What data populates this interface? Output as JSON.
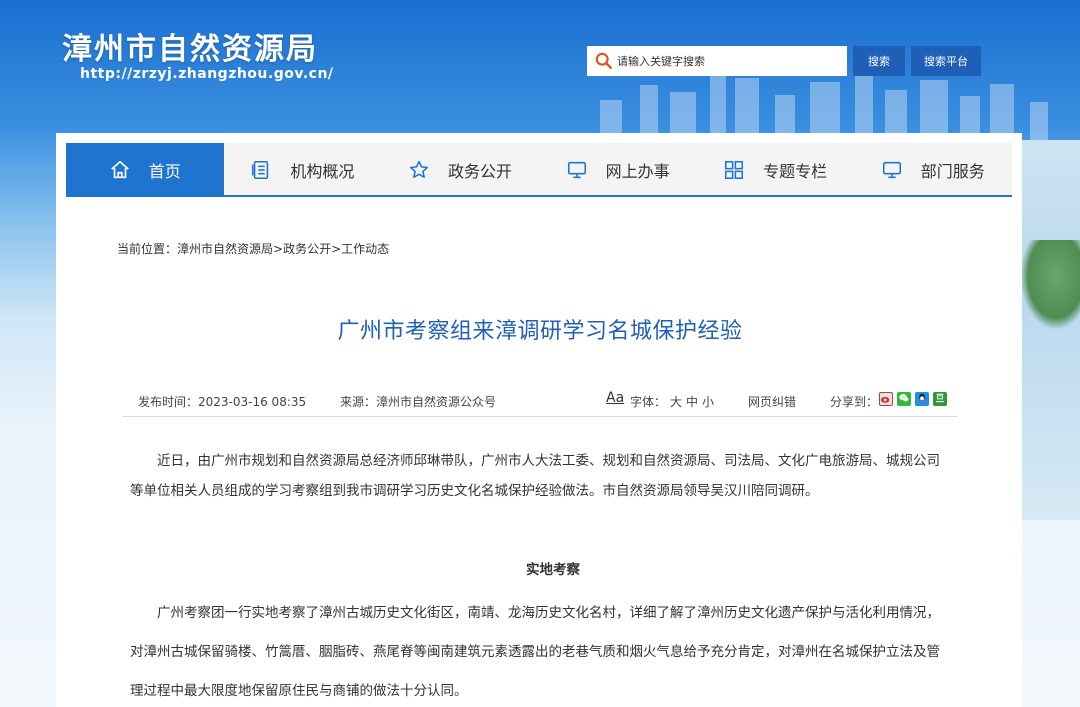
{
  "header": {
    "site_title": "漳州市自然资源局",
    "site_url": "http://zrzyj.zhangzhou.gov.cn/",
    "search_placeholder": "请输入关键字搜索",
    "search_button": "搜索",
    "platform_button": "搜索平台"
  },
  "nav": {
    "items": [
      {
        "label": "首页",
        "icon": "home-icon",
        "active": true
      },
      {
        "label": "机构概况",
        "icon": "document-list-icon"
      },
      {
        "label": "政务公开",
        "icon": "star-icon"
      },
      {
        "label": "网上办事",
        "icon": "monitor-icon"
      },
      {
        "label": "专题专栏",
        "icon": "grid-icon"
      },
      {
        "label": "部门服务",
        "icon": "monitor-icon"
      }
    ]
  },
  "breadcrumb": {
    "prefix": "当前位置：",
    "items": [
      "漳州市自然资源局",
      "政务公开",
      "工作动态"
    ],
    "separator": ">"
  },
  "article": {
    "title": "广州市考察组来漳调研学习名城保护经验",
    "publish_label": "发布时间：2023-03-16 08:35",
    "source_label": "来源：漳州市自然资源公众号",
    "font_aa": "Aa",
    "font_label": "字体：",
    "font_sizes": [
      "大",
      "中",
      "小"
    ],
    "correction": "网页纠错",
    "share_label": "分享到：",
    "paragraph1": "近日，由广州市规划和自然资源局总经济师邱琳带队，广州市人大法工委、规划和自然资源局、司法局、文化广电旅游局、城规公司等单位相关人员组成的学习考察组到我市调研学习历史文化名城保护经验做法。市自然资源局领导吴汉川陪同调研。",
    "subheading": "实地考察",
    "paragraph2": "广州考察团一行实地考察了漳州古城历史文化街区，南靖、龙海历史文化名村，详细了解了漳州历史文化遗产保护与活化利用情况，对漳州古城保留骑楼、竹篙厝、胭脂砖、燕尾脊等闽南建筑元素透露出的老巷气质和烟火气息给予充分肯定，对漳州在名城保护立法及管理过程中最大限度地保留原住民与商铺的做法十分认同。"
  },
  "colors": {
    "primary": "#1f74d0",
    "title_blue": "#1f5fb8",
    "button_blue": "#1f5fb8"
  }
}
